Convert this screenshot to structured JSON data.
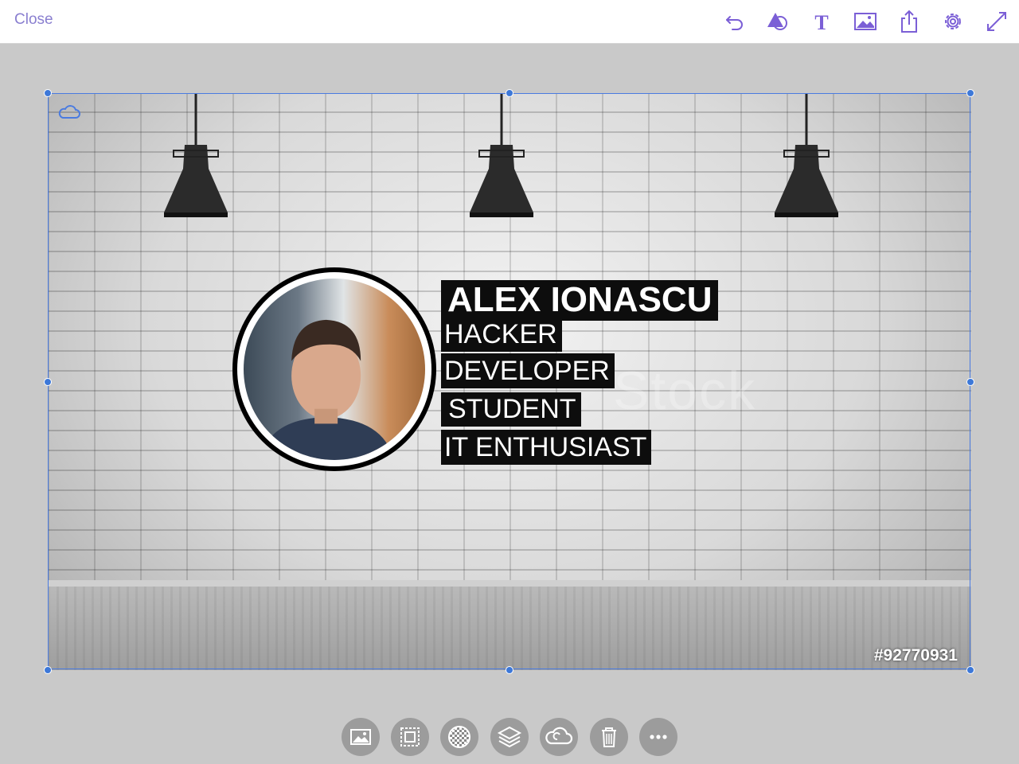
{
  "toolbar": {
    "close_label": "Close",
    "accent_color": "#7b5fd6",
    "tools": [
      {
        "name": "undo-icon"
      },
      {
        "name": "shape-icon"
      },
      {
        "name": "text-icon",
        "glyph": "T"
      },
      {
        "name": "image-icon"
      },
      {
        "name": "share-icon"
      },
      {
        "name": "settings-icon"
      },
      {
        "name": "fullscreen-icon"
      }
    ]
  },
  "canvas": {
    "name_text": "ALEX IONASCU",
    "roles": [
      "HACKER",
      "DEVELOPER",
      "STUDENT",
      "IT ENTHUSIAST"
    ],
    "watermark": "Stock",
    "stock_id": "#92770931",
    "selection_color": "#3d78d8"
  },
  "bottom_toolbar": {
    "buttons": [
      {
        "name": "replace-image-icon"
      },
      {
        "name": "crop-icon"
      },
      {
        "name": "opacity-icon"
      },
      {
        "name": "layers-icon"
      },
      {
        "name": "creative-cloud-icon"
      },
      {
        "name": "trash-icon"
      },
      {
        "name": "more-icon"
      }
    ]
  }
}
